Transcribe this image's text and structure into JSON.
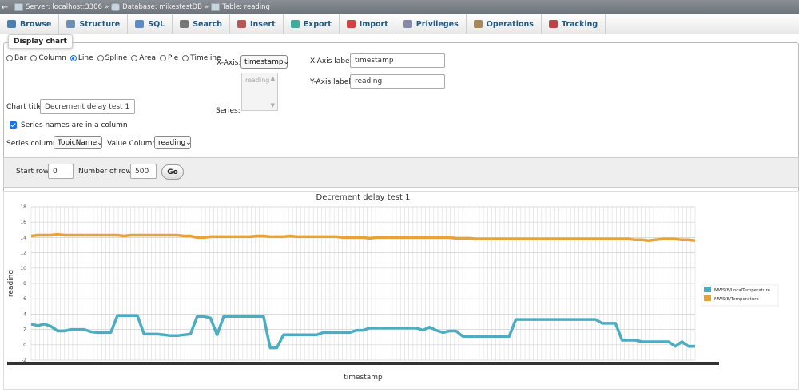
{
  "breadcrumb": {
    "server": "Server: localhost:3306",
    "database": "Database: mikestestDB",
    "table": "Table: reading",
    "separator": "»"
  },
  "tabs": [
    {
      "label": "Browse",
      "icon": "browse-icon",
      "color": "#4a7fb5"
    },
    {
      "label": "Structure",
      "icon": "structure-icon",
      "color": "#6b8fb5"
    },
    {
      "label": "SQL",
      "icon": "sql-icon",
      "color": "#5b8cc6"
    },
    {
      "label": "Search",
      "icon": "search-icon",
      "color": "#777"
    },
    {
      "label": "Insert",
      "icon": "insert-icon",
      "color": "#b55"
    },
    {
      "label": "Export",
      "icon": "export-icon",
      "color": "#4a9"
    },
    {
      "label": "Import",
      "icon": "import-icon",
      "color": "#c44"
    },
    {
      "label": "Privileges",
      "icon": "privileges-icon",
      "color": "#88a"
    },
    {
      "label": "Operations",
      "icon": "operations-icon",
      "color": "#a85"
    },
    {
      "label": "Tracking",
      "icon": "tracking-icon",
      "color": "#b44"
    }
  ],
  "display_chart": {
    "legend": "Display chart",
    "chart_types": [
      {
        "label": "Bar",
        "selected": false
      },
      {
        "label": "Column",
        "selected": false
      },
      {
        "label": "Line",
        "selected": true
      },
      {
        "label": "Spline",
        "selected": false
      },
      {
        "label": "Area",
        "selected": false
      },
      {
        "label": "Pie",
        "selected": false
      },
      {
        "label": "Timeline",
        "selected": false
      }
    ],
    "x_axis_label_text": "X-Axis:",
    "x_axis_value": "timestamp",
    "series_label": "Series:",
    "series_option": "reading",
    "x_axis_label_field_label": "X-Axis label:",
    "x_axis_label_field_value": "timestamp",
    "y_axis_label_field_label": "Y-Axis label:",
    "y_axis_label_field_value": "reading",
    "chart_title_label": "Chart title:",
    "chart_title_value": "Decrement delay test 1",
    "series_in_column_label": "Series names are in a column",
    "series_column_label": "Series column:",
    "series_column_value": "TopicName",
    "value_column_label": "Value Column:",
    "value_column_value": "reading"
  },
  "rows": {
    "start_row_label": "Start row:",
    "start_row_value": "0",
    "number_of_rows_label": "Number of rows:",
    "number_of_rows_value": "500",
    "go_label": "Go"
  },
  "chart_data": {
    "type": "line",
    "title": "Decrement delay test 1",
    "xlabel": "timestamp",
    "ylabel": "reading",
    "ylim": [
      -2,
      18
    ],
    "yticks": [
      -2,
      0,
      2,
      4,
      6,
      8,
      10,
      12,
      14,
      16,
      18
    ],
    "grid": true,
    "legend_position": "right",
    "x": [
      0,
      1,
      2,
      3,
      4,
      5,
      6,
      7,
      8,
      9,
      10,
      11,
      12,
      13,
      14,
      15,
      16,
      17,
      18,
      19,
      20,
      21,
      22,
      23,
      24,
      25,
      26,
      27,
      28,
      29,
      30,
      31,
      32,
      33,
      34,
      35,
      36,
      37,
      38,
      39,
      40,
      41,
      42,
      43,
      44,
      45,
      46,
      47,
      48,
      49,
      50,
      51,
      52,
      53,
      54,
      55,
      56,
      57,
      58,
      59,
      60,
      61,
      62,
      63,
      64,
      65,
      66,
      67,
      68,
      69,
      70,
      71,
      72,
      73,
      74,
      75,
      76,
      77,
      78,
      79,
      80,
      81,
      82,
      83,
      84,
      85,
      86,
      87,
      88,
      89,
      90,
      91,
      92,
      93,
      94,
      95,
      96,
      97,
      98,
      99,
      100
    ],
    "series": [
      {
        "name": "MWS/8/LocalTemperature",
        "color": "#4aaec0",
        "values": [
          2.7,
          2.5,
          2.7,
          2.4,
          1.8,
          1.8,
          2.0,
          2.0,
          2.0,
          1.7,
          1.6,
          1.6,
          1.6,
          3.8,
          3.8,
          3.8,
          3.8,
          1.4,
          1.4,
          1.4,
          1.3,
          1.2,
          1.2,
          1.3,
          1.4,
          3.7,
          3.7,
          3.5,
          1.3,
          3.7,
          3.7,
          3.7,
          3.7,
          3.7,
          3.7,
          3.7,
          -0.4,
          -0.4,
          1.3,
          1.3,
          1.3,
          1.3,
          1.3,
          1.3,
          1.6,
          1.6,
          1.6,
          1.6,
          1.6,
          1.9,
          1.9,
          2.2,
          2.2,
          2.2,
          2.2,
          2.2,
          2.2,
          2.2,
          2.2,
          1.9,
          2.3,
          1.9,
          1.6,
          1.8,
          1.8,
          1.1,
          1.1,
          1.1,
          1.1,
          1.1,
          1.1,
          1.1,
          1.1,
          3.3,
          3.3,
          3.3,
          3.3,
          3.3,
          3.3,
          3.3,
          3.3,
          3.3,
          3.3,
          3.3,
          3.3,
          3.3,
          2.8,
          2.8,
          2.8,
          0.6,
          0.6,
          0.6,
          0.4,
          0.4,
          0.4,
          0.4,
          0.4,
          -0.2,
          0.4,
          -0.2,
          -0.2
        ]
      },
      {
        "name": "MWS/8/Temperature",
        "color": "#e8a23a",
        "values": [
          14.2,
          14.3,
          14.3,
          14.3,
          14.4,
          14.3,
          14.3,
          14.3,
          14.3,
          14.3,
          14.3,
          14.3,
          14.3,
          14.3,
          14.2,
          14.3,
          14.3,
          14.3,
          14.3,
          14.3,
          14.3,
          14.3,
          14.3,
          14.2,
          14.2,
          14.0,
          14.0,
          14.1,
          14.1,
          14.1,
          14.1,
          14.1,
          14.1,
          14.1,
          14.2,
          14.2,
          14.1,
          14.1,
          14.1,
          14.2,
          14.1,
          14.1,
          14.1,
          14.1,
          14.1,
          14.1,
          14.1,
          14.0,
          14.0,
          14.0,
          14.0,
          13.9,
          14.0,
          14.0,
          14.0,
          14.0,
          14.0,
          14.0,
          14.0,
          14.0,
          14.0,
          14.0,
          14.0,
          14.0,
          13.9,
          13.9,
          13.9,
          13.8,
          13.8,
          13.8,
          13.8,
          13.8,
          13.8,
          13.8,
          13.8,
          13.8,
          13.8,
          13.8,
          13.8,
          13.8,
          13.8,
          13.8,
          13.8,
          13.8,
          13.8,
          13.8,
          13.8,
          13.8,
          13.8,
          13.8,
          13.8,
          13.7,
          13.7,
          13.6,
          13.7,
          13.8,
          13.8,
          13.8,
          13.7,
          13.7,
          13.6
        ]
      }
    ]
  }
}
